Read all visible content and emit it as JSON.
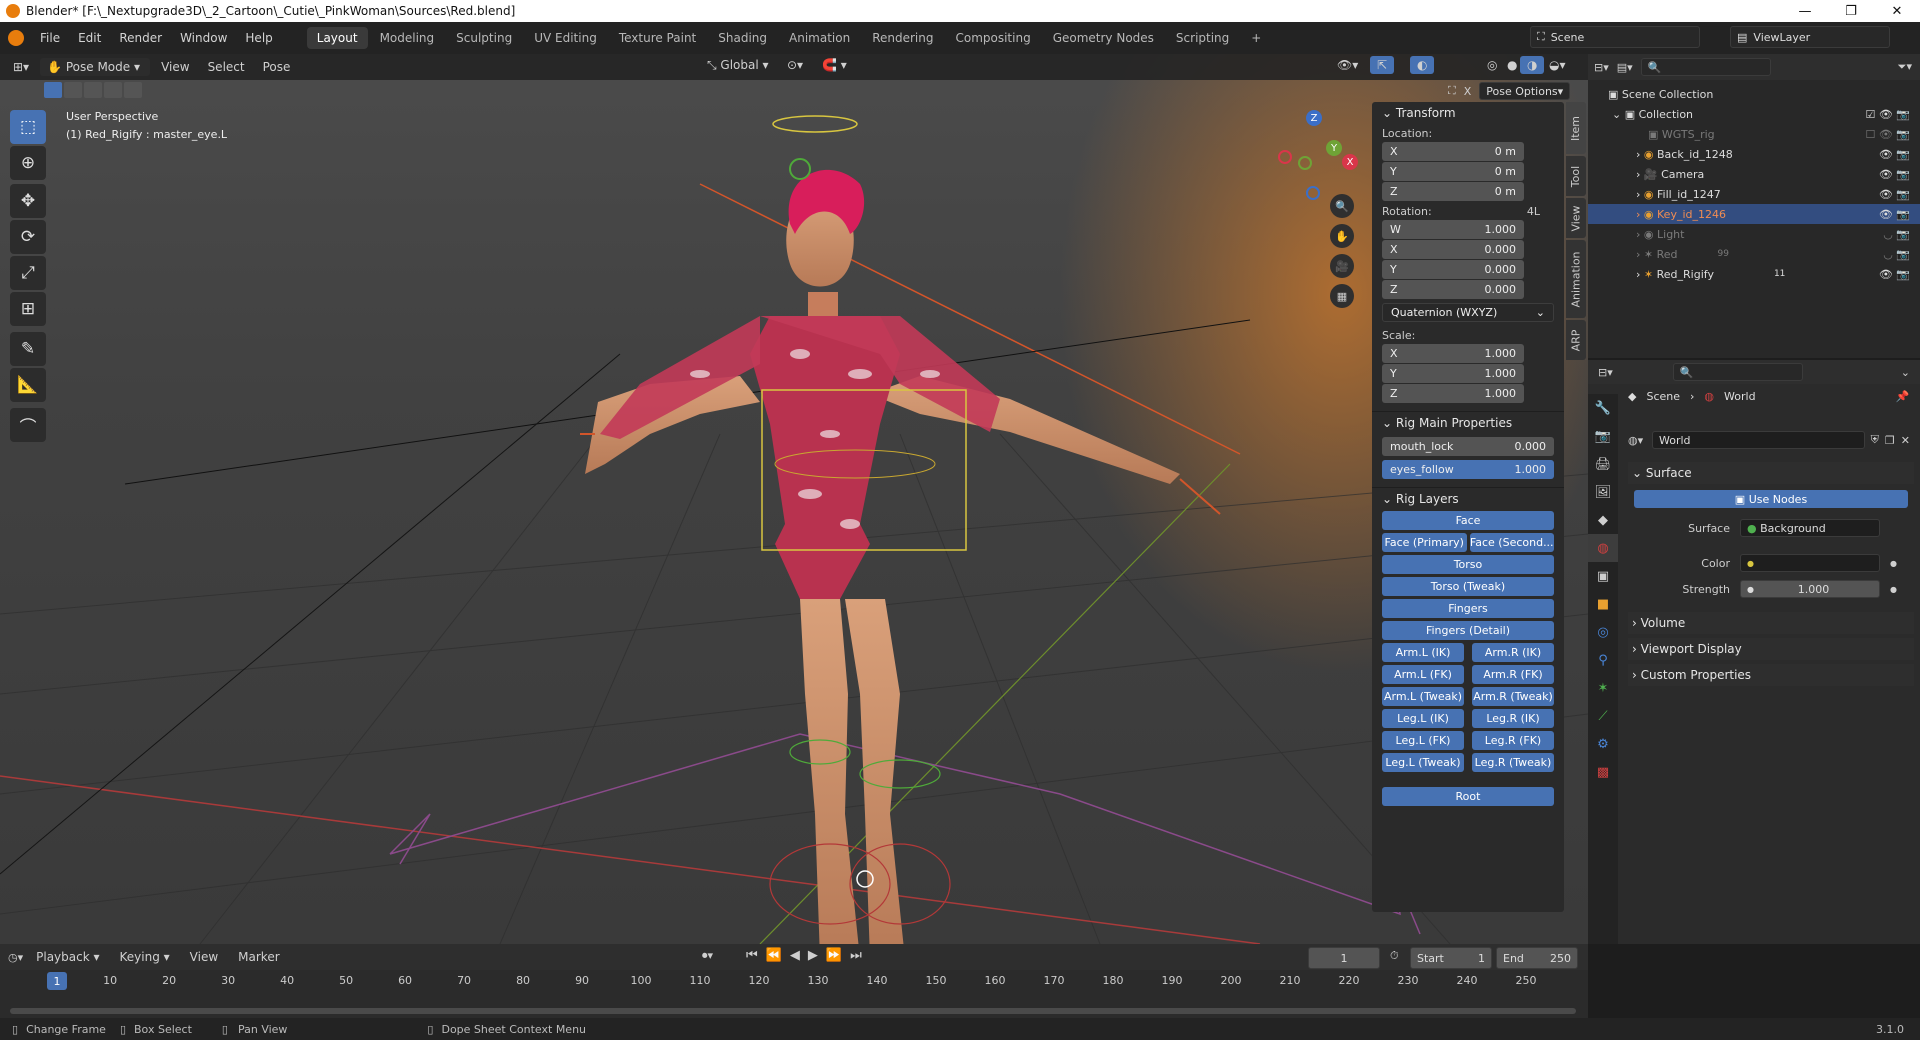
{
  "titlebar": {
    "title": "Blender* [F:\\_Nextupgrade3D\\_2_Cartoon\\_Cutie\\_PinkWoman\\Sources\\Red.blend]",
    "min": "—",
    "max": "❐",
    "close": "✕"
  },
  "menu": {
    "items": [
      "File",
      "Edit",
      "Render",
      "Window",
      "Help"
    ]
  },
  "workspaces": [
    "Layout",
    "Modeling",
    "Sculpting",
    "UV Editing",
    "Texture Paint",
    "Shading",
    "Animation",
    "Rendering",
    "Compositing",
    "Geometry Nodes",
    "Scripting"
  ],
  "scene": {
    "label": "Scene",
    "viewlayer": "ViewLayer"
  },
  "viewport": {
    "mode": "Pose Mode",
    "menus": [
      "View",
      "Select",
      "Pose"
    ],
    "orientation": "Global",
    "pose_options": "Pose Options",
    "overlay_title": "User Perspective",
    "overlay_sub": "(1) Red_Rigify : master_eye.L",
    "gizmo": {
      "z": "Z",
      "y": "Y",
      "x": "X"
    }
  },
  "npanel": {
    "transform_title": "Transform",
    "location_label": "Location:",
    "location": [
      {
        "axis": "X",
        "value": "0 m"
      },
      {
        "axis": "Y",
        "value": "0 m"
      },
      {
        "axis": "Z",
        "value": "0 m"
      }
    ],
    "rotation_label": "Rotation:",
    "rotation_lock": "4L",
    "rotation": [
      {
        "axis": "W",
        "value": "1.000"
      },
      {
        "axis": "X",
        "value": "0.000"
      },
      {
        "axis": "Y",
        "value": "0.000"
      },
      {
        "axis": "Z",
        "value": "0.000"
      }
    ],
    "rotation_mode": "Quaternion (WXYZ)",
    "scale_label": "Scale:",
    "scale": [
      {
        "axis": "X",
        "value": "1.000"
      },
      {
        "axis": "Y",
        "value": "1.000"
      },
      {
        "axis": "Z",
        "value": "1.000"
      }
    ],
    "rig_main_title": "Rig Main Properties",
    "mouth_lock_label": "mouth_lock",
    "mouth_lock_value": "0.000",
    "eyes_follow_label": "eyes_follow",
    "eyes_follow_value": "1.000",
    "rig_layers_title": "Rig Layers",
    "layers": {
      "face": "Face",
      "face_primary": "Face (Primary)",
      "face_secondary": "Face (Second...",
      "torso": "Torso",
      "torso_tweak": "Torso (Tweak)",
      "fingers": "Fingers",
      "fingers_detail": "Fingers (Detail)",
      "arm_l_ik": "Arm.L (IK)",
      "arm_r_ik": "Arm.R (IK)",
      "arm_l_fk": "Arm.L (FK)",
      "arm_r_fk": "Arm.R (FK)",
      "arm_l_tweak": "Arm.L (Tweak)",
      "arm_r_tweak": "Arm.R (Tweak)",
      "leg_l_ik": "Leg.L (IK)",
      "leg_r_ik": "Leg.R (IK)",
      "leg_l_fk": "Leg.L (FK)",
      "leg_r_fk": "Leg.R (FK)",
      "leg_l_tweak": "Leg.L (Tweak)",
      "leg_r_tweak": "Leg.R (Tweak)",
      "root": "Root"
    },
    "tabs": [
      "Item",
      "Tool",
      "View",
      "Animation",
      "ARP"
    ]
  },
  "outliner": {
    "scene_collection": "Scene Collection",
    "collection": "Collection",
    "rows": [
      "WGTS_rig",
      "Back_id_1248",
      "Camera",
      "Fill_id_1247",
      "Key_id_1246",
      "Light",
      "Red",
      "Red_Rigify"
    ],
    "badge_red": "99",
    "badge_rigify": "11"
  },
  "properties": {
    "breadcrumb_scene": "Scene",
    "breadcrumb_world": "World",
    "world_name": "World",
    "surface_title": "Surface",
    "use_nodes": "Use Nodes",
    "surface_label": "Surface",
    "surface_value": "Background",
    "color_label": "Color",
    "strength_label": "Strength",
    "strength_value": "1.000",
    "volume": "Volume",
    "viewport_display": "Viewport Display",
    "custom_properties": "Custom Properties",
    "accent": "#4772b3"
  },
  "timeline": {
    "menus": [
      "Playback",
      "Keying",
      "View",
      "Marker"
    ],
    "current_frame": "1",
    "start_label": "Start",
    "start": "1",
    "end_label": "End",
    "end": "250",
    "ticks": [
      "10",
      "20",
      "30",
      "40",
      "50",
      "60",
      "70",
      "80",
      "90",
      "100",
      "110",
      "120",
      "130",
      "140",
      "150",
      "160",
      "170",
      "180",
      "190",
      "200",
      "210",
      "220",
      "230",
      "240",
      "250"
    ],
    "playhead": "1"
  },
  "status": {
    "change_frame": "Change Frame",
    "box_select": "Box Select",
    "pan_view": "Pan View",
    "context_menu": "Dope Sheet Context Menu",
    "version": "3.1.0"
  }
}
